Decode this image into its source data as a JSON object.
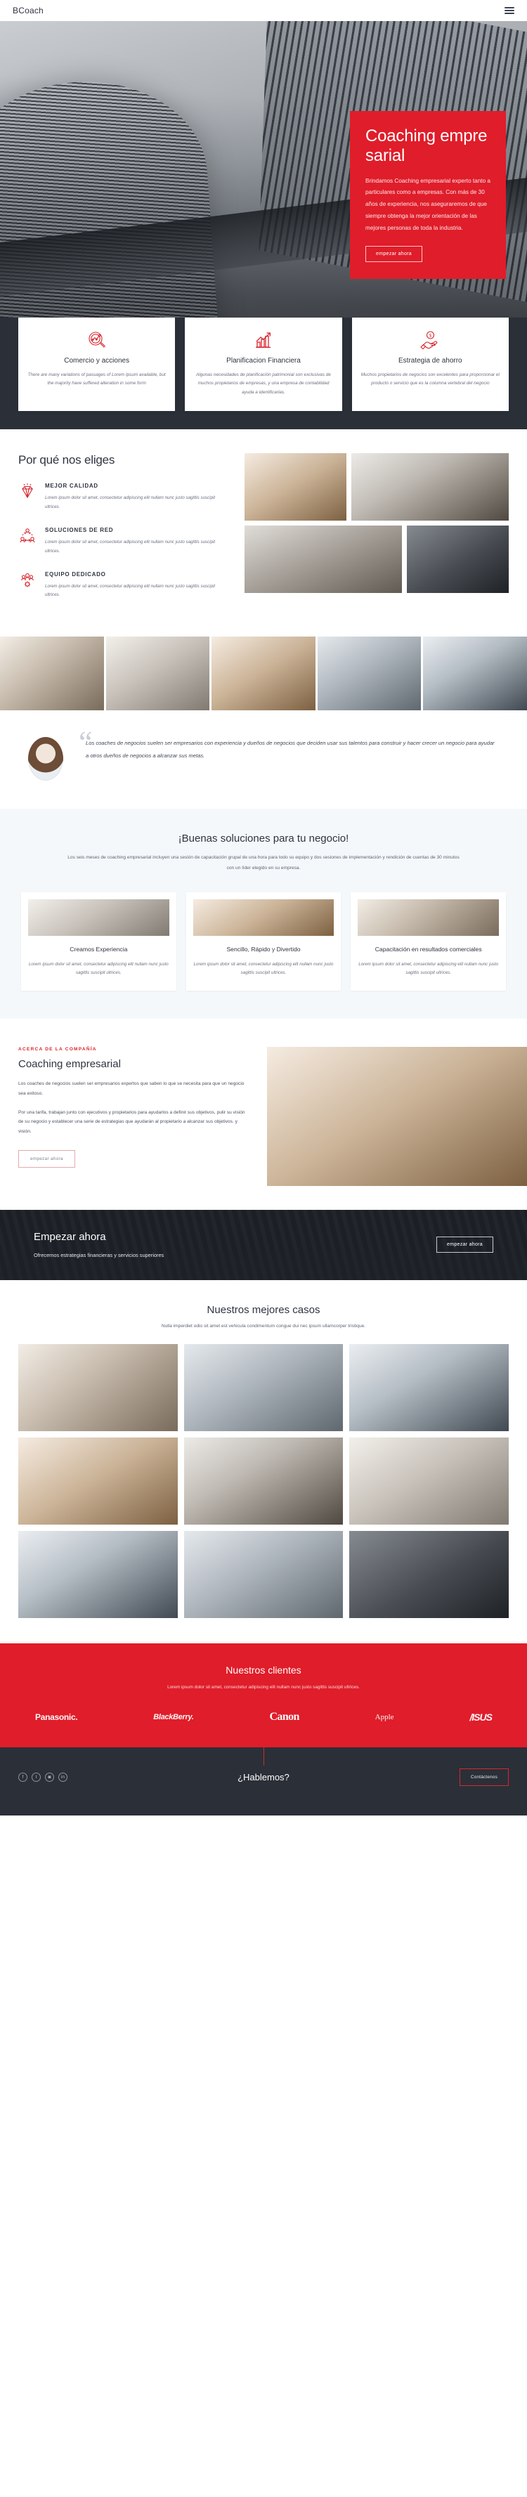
{
  "header": {
    "logo": "BCoach",
    "menu_icon": "hamburger-icon"
  },
  "hero": {
    "title": "Coaching empresarial",
    "paragraph": "Brindamos Coaching empresarial experto tanto a particulares como a empresas. Con más de 30 años de experiencia, nos aseguraremos de que siempre obtenga la mejor orientación de las mejores personas de toda la industria.",
    "cta_label": "empezar ahora"
  },
  "features": [
    {
      "icon": "magnifier-chart-icon",
      "title": "Comercio y acciones",
      "text": "There are many variations of passages of Lorem Ipsum available, but the majority have suffered alteration in some form"
    },
    {
      "icon": "bar-chart-growth-icon",
      "title": "Planificacion Financiera",
      "text": "Algunas necesidades de planificación patrimonial son exclusivas de muchos propietarios de empresas, y una empresa de contabilidad ayuda a identificarlas."
    },
    {
      "icon": "hand-coin-icon",
      "title": "Estrategia de ahorro",
      "text": "Muchos propietarios de negocios son excelentes para proporcionar el producto o servicio que es la columna vertebral del negocio"
    }
  ],
  "why": {
    "title": "Por qué nos eliges",
    "items": [
      {
        "icon": "diamond-icon",
        "title": "MEJOR CALIDAD",
        "text": "Lorem ipsum dolor sit amet, consectetur adipiscing elit nullam nunc justo sagittis suscipit ultrices."
      },
      {
        "icon": "network-nodes-icon",
        "title": "SOLUCIONES DE RED",
        "text": "Lorem ipsum dolor sit amet, consectetur adipiscing elit nullam nunc justo sagittis suscipit ultrices."
      },
      {
        "icon": "team-gear-icon",
        "title": "EQUIPO DEDICADO",
        "text": "Lorem ipsum dolor sit amet, consectetur adipiscing elit nullam nunc justo sagittis suscipit ultrices."
      }
    ]
  },
  "quote": {
    "mark": "“",
    "text": "Los coaches de negocios suelen ser empresarios con experiencia y dueños de negocios que deciden usar sus talentos para construir y hacer crecer un negocio para ayudar a otros dueños de negocios a alcanzar sus metas."
  },
  "solutions": {
    "title": "¡Buenas soluciones para tu negocio!",
    "lead": "Los seis meses de coaching empresarial incluyen una sesión de capacitación grupal de una hora para todo su equipo y dos sesiones de implementación y rendición de cuentas de 30 minutos con un líder elegido en su empresa.",
    "cards": [
      {
        "title": "Creamos Experiencia",
        "text": "Lorem ipsum dolor sit amet, consectetur adipiscing elit nullam nunc justo sagittis suscipit ultrices."
      },
      {
        "title": "Sencillo, Rápido y Divertido",
        "text": "Lorem ipsum dolor sit amet, consectetur adipiscing elit nullam nunc justo sagittis suscipit ultrices."
      },
      {
        "title": "Capacitación en resultados comerciales",
        "text": "Lorem ipsum dolor sit amet, consectetur adipiscing elit nullam nunc justo sagittis suscipit ultrices."
      }
    ]
  },
  "about": {
    "eyebrow": "ACERCA DE LA COMPAÑÍA",
    "title": "Coaching empresarial",
    "paragraph1": "Los coaches de negocios suelen ser empresarios expertos que saben lo que se necesita para que un negocio sea exitoso.",
    "paragraph2": "Por una tarifa, trabajan junto con ejecutivos y propietarios para ayudarlos a definir sus objetivos, pulir su visión de su negocio y establecer una serie de estrategias que ayudarán al propietario a alcanzar sus objetivos. y visión.",
    "cta_label": "empezar ahora"
  },
  "cta": {
    "title": "Empezar ahora",
    "subtitle": "Ofrecemos estrategias financieras y servicios superiores",
    "button_label": "empezar ahora"
  },
  "cases": {
    "title": "Nuestros mejores casos",
    "lead": "Nulla imperdiet odio sit amet est vehicula condimentum congue dui nec ipsum ullamcorper tristique."
  },
  "clients": {
    "title": "Nuestros clientes",
    "lead": "Lorem ipsum dolor sit amet, consectetur adipiscing elit nullam nunc justo sagittis suscipit ultrices.",
    "logos": [
      "Panasonic.",
      "BlackBerry.",
      "Canon",
      "Apple",
      "/ISUS"
    ]
  },
  "footer": {
    "title": "¿Hablemos?",
    "button_label": "Contáctenos",
    "socials": [
      "facebook-icon",
      "twitter-icon",
      "instagram-icon",
      "linkedin-icon"
    ],
    "social_glyphs": [
      "f",
      "t",
      "◙",
      "in"
    ]
  },
  "colors": {
    "accent": "#e01d2a",
    "dark": "#2b2f38",
    "text": "#3d4351"
  }
}
